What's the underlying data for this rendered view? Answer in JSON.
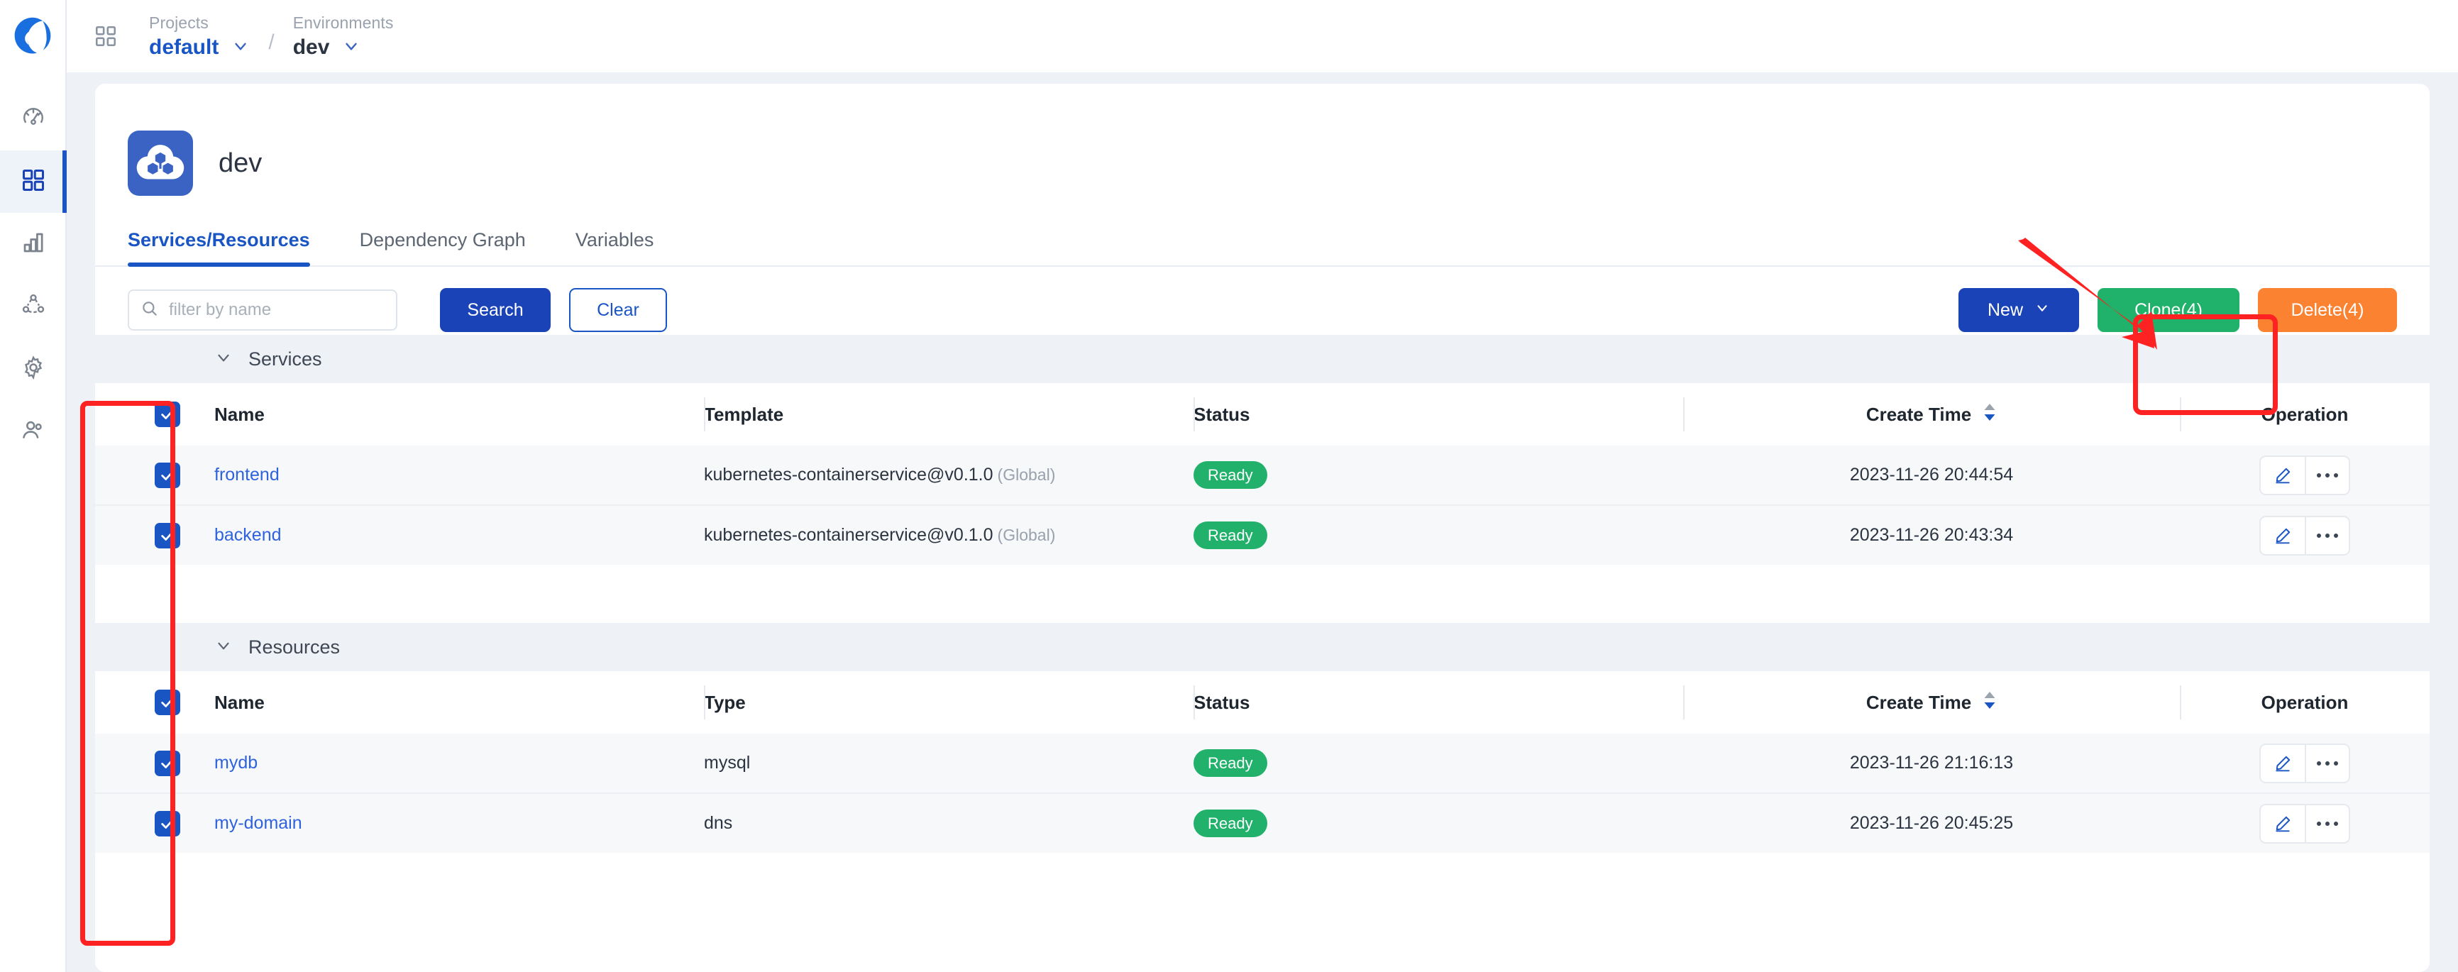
{
  "topbar": {
    "logo_icon": "company-logo-icon",
    "apps_icon": "apps-grid-icon",
    "projects": {
      "label": "Projects",
      "value": "default",
      "chevron_icon": "chevron-down-icon"
    },
    "separator": "/",
    "environments": {
      "label": "Environments",
      "value": "dev",
      "chevron_icon": "chevron-down-icon"
    }
  },
  "sidebar": {
    "items": [
      {
        "name": "dashboard",
        "icon": "gauge-icon",
        "active": false
      },
      {
        "name": "applications",
        "icon": "grid-icon",
        "active": true
      },
      {
        "name": "reports",
        "icon": "bar-chart-icon",
        "active": false
      },
      {
        "name": "topology",
        "icon": "network-share-icon",
        "active": false
      },
      {
        "name": "settings",
        "icon": "gear-icon",
        "active": false
      },
      {
        "name": "users",
        "icon": "users-icon",
        "active": false
      }
    ]
  },
  "env_header": {
    "icon": "cloud-cubes-icon",
    "title": "dev"
  },
  "tabs": [
    {
      "label": "Services/Resources",
      "active": true
    },
    {
      "label": "Dependency Graph",
      "active": false
    },
    {
      "label": "Variables",
      "active": false
    }
  ],
  "toolbar": {
    "search_icon": "search-icon",
    "search_value": "",
    "search_placeholder": "filter by name",
    "search_button": "Search",
    "clear_button": "Clear",
    "new_button": "New",
    "new_chevron_icon": "chevron-down-icon",
    "clone_button": "Clone(4)",
    "delete_button": "Delete(4)"
  },
  "colors": {
    "brand_blue": "#1a43b8",
    "link_blue": "#2f62dd",
    "success_green": "#20b26a",
    "warn_orange": "#fa8231",
    "annotation_red": "#fe2222"
  },
  "services_section": {
    "title": "Services",
    "collapse_icon": "chevron-down-icon",
    "header_checked": true,
    "columns": [
      "Name",
      "Template",
      "Status",
      "Create Time",
      "Operation"
    ],
    "sort_column": "Create Time",
    "sort_direction": "desc",
    "rows": [
      {
        "checked": true,
        "name": "frontend",
        "template": "kubernetes-containerservice@v0.1.0",
        "template_scope": "(Global)",
        "status": "Ready",
        "create_time": "2023-11-26 20:44:54",
        "operations": [
          "edit-icon",
          "more-icon"
        ]
      },
      {
        "checked": true,
        "name": "backend",
        "template": "kubernetes-containerservice@v0.1.0",
        "template_scope": "(Global)",
        "status": "Ready",
        "create_time": "2023-11-26 20:43:34",
        "operations": [
          "edit-icon",
          "more-icon"
        ]
      }
    ]
  },
  "resources_section": {
    "title": "Resources",
    "collapse_icon": "chevron-down-icon",
    "header_checked": true,
    "columns": [
      "Name",
      "Type",
      "Status",
      "Create Time",
      "Operation"
    ],
    "sort_column": "Create Time",
    "sort_direction": "desc",
    "rows": [
      {
        "checked": true,
        "name": "mydb",
        "type": "mysql",
        "status": "Ready",
        "create_time": "2023-11-26 21:16:13",
        "operations": [
          "edit-icon",
          "more-icon"
        ]
      },
      {
        "checked": true,
        "name": "my-domain",
        "type": "dns",
        "status": "Ready",
        "create_time": "2023-11-26 20:45:25",
        "operations": [
          "edit-icon",
          "more-icon"
        ]
      }
    ]
  },
  "annotations": {
    "arrow": "red-arrow-pointing-to-clone-button",
    "highlight_clone": "red-box-around-clone-button",
    "highlight_checkboxes": "red-box-around-checkbox-column"
  }
}
